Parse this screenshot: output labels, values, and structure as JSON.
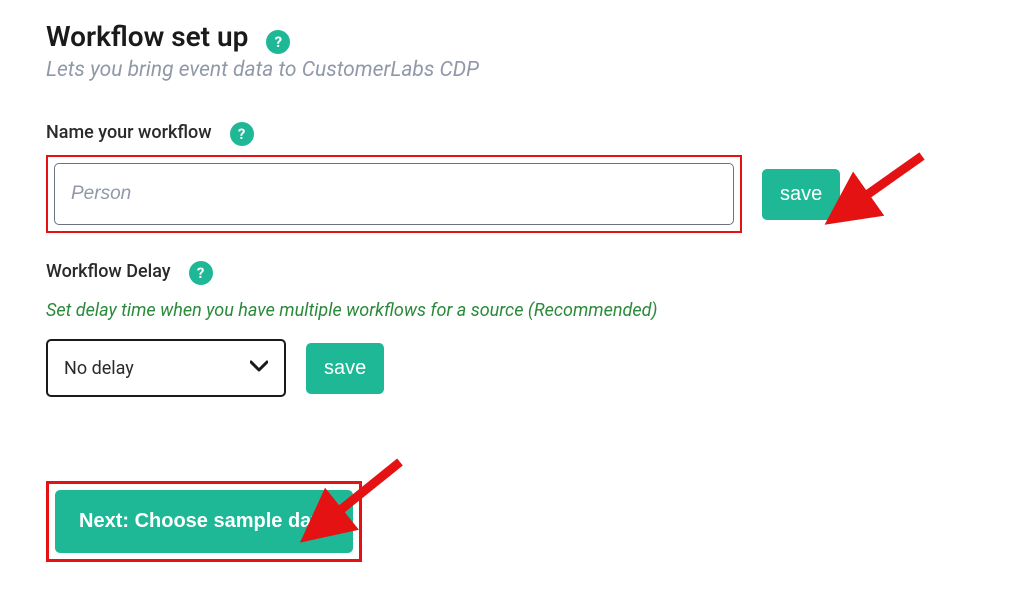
{
  "header": {
    "title": "Workflow set up",
    "subtitle": "Lets you bring event data to CustomerLabs CDP"
  },
  "workflow_name": {
    "label": "Name your workflow",
    "value": "Person",
    "save_label": "save"
  },
  "workflow_delay": {
    "label": "Workflow Delay",
    "hint": "Set delay time when you have multiple workflows for a source (Recommended)",
    "selected": "No delay",
    "save_label": "save"
  },
  "next_button": {
    "label": "Next: Choose sample data"
  },
  "help_icon_glyph": "?"
}
